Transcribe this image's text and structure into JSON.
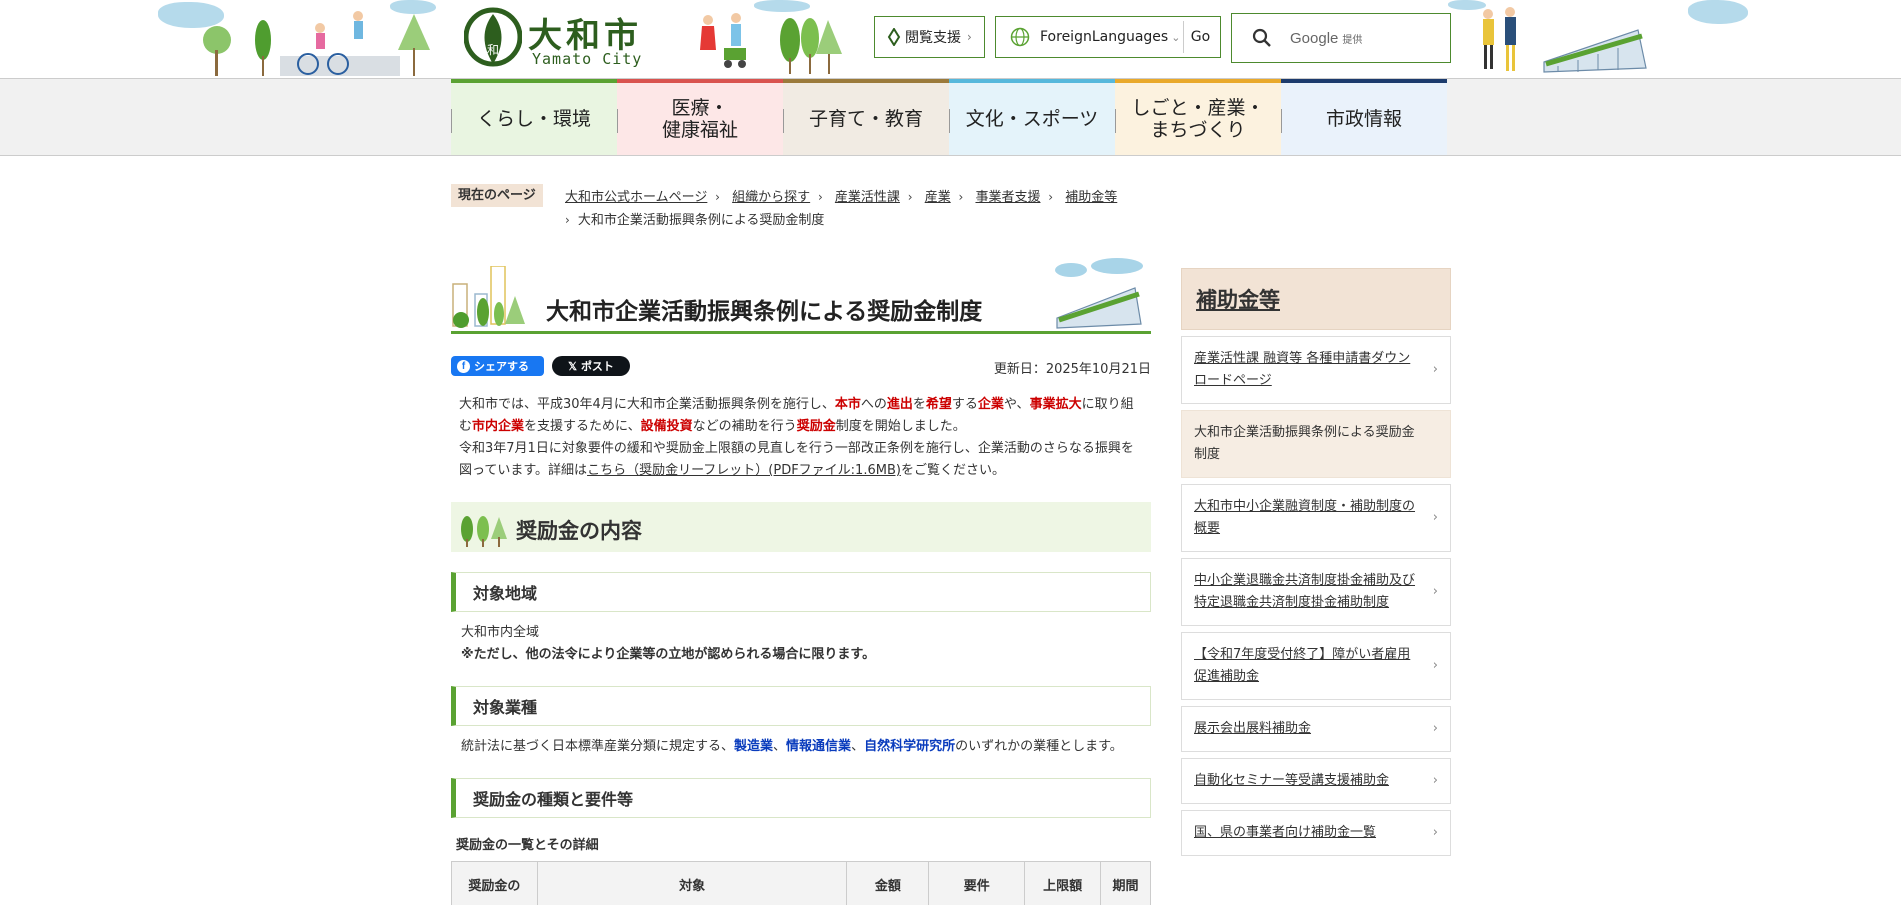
{
  "header": {
    "logo_jp": "大和市",
    "logo_en": "Yamato City",
    "reader_support_label": "閲覧支援",
    "language_label": "ForeignLanguages",
    "go_label": "Go",
    "search_brand": "Google",
    "search_provided": "提供"
  },
  "nav": {
    "items": [
      {
        "label": "くらし・環境",
        "bg": "#e9f5e1",
        "accent": "#5aa232"
      },
      {
        "label": "医療・\n健康福祉",
        "bg": "#fde7e7",
        "accent": "#d9534f"
      },
      {
        "label": "子育て・教育",
        "bg": "#f1ebe3",
        "accent": "#9b7a3b"
      },
      {
        "label": "文化・スポーツ",
        "bg": "#e4f3fa",
        "accent": "#56b8dc"
      },
      {
        "label": "しごと・産業・\nまちづくり",
        "bg": "#fcf2df",
        "accent": "#e9a92b"
      },
      {
        "label": "市政情報",
        "bg": "#eaf2fb",
        "accent": "#1c3b6d"
      }
    ]
  },
  "breadcrumb": {
    "here_label": "現在のページ",
    "items": [
      "大和市公式ホームページ",
      "組織から探す",
      "産業活性課",
      "産業",
      "事業者支援",
      "補助金等"
    ],
    "current": "大和市企業活動振興条例による奨励金制度"
  },
  "main": {
    "title": "大和市企業活動振興条例による奨励金制度",
    "share_label": "シェアする",
    "post_label": "ポスト",
    "updated": "更新日：2025年10月21日",
    "intro_p1": {
      "t1": "大和市では、平成30年4月に大和市企業活動振興条例を施行し、",
      "r1": "本市",
      "t2": "への",
      "r2": "進出",
      "t3": "を",
      "r3": "希望",
      "t4": "する",
      "r4": "企業",
      "t5": "や、",
      "r5": "事業拡大",
      "t6": "に取り組む",
      "r6": "市内企業",
      "t7": "を支援するために、",
      "r7": "設備投資",
      "t8": "などの補助を行う",
      "r8": "奨励金",
      "t9": "制度を開始しました。"
    },
    "intro_p2": {
      "t1": "令和3年7月1日に対象要件の緩和や奨励金上限額の見直しを行う一部改正条例を施行し、企業活動のさらなる振興を図っています。詳細は",
      "link": "こちら（奨励金リーフレット）(PDFファイル:1.6MB)",
      "t2": "をご覧ください。"
    },
    "h2": "奨励金の内容",
    "sections": {
      "area_heading": "対象地域",
      "area_text": "大和市内全域",
      "area_note": "※ただし、他の法令により企業等の立地が認められる場合に限ります。",
      "industry_heading": "対象業種",
      "industry_t1": "統計法に基づく日本標準産業分類に規定する、",
      "industry_b1": "製造業",
      "industry_sep1": "、",
      "industry_b2": "情報通信業",
      "industry_sep2": "、",
      "industry_b3": "自然科学研究所",
      "industry_t2": "のいずれかの業種とします。",
      "types_heading": "奨励金の種類と要件等",
      "table_caption": "奨励金の一覧とその詳細",
      "table_headers": [
        "奨励金の",
        "対象",
        "金額",
        "要件",
        "上限額",
        "期間"
      ]
    }
  },
  "sidebar": {
    "heading": "補助金等",
    "items": [
      {
        "label": "産業活性課 融資等 各種申請書ダウンロードページ",
        "current": false
      },
      {
        "label": "大和市企業活動振興条例による奨励金制度",
        "current": true
      },
      {
        "label": "大和市中小企業融資制度・補助制度の概要",
        "current": false
      },
      {
        "label": "中小企業退職金共済制度掛金補助及び特定退職金共済制度掛金補助制度",
        "current": false
      },
      {
        "label": "【令和7年度受付終了】障がい者雇用促進補助金",
        "current": false
      },
      {
        "label": "展示会出展料補助金",
        "current": false
      },
      {
        "label": "自動化セミナー等受講支援補助金",
        "current": false
      },
      {
        "label": "国、県の事業者向け補助金一覧",
        "current": false
      }
    ]
  }
}
